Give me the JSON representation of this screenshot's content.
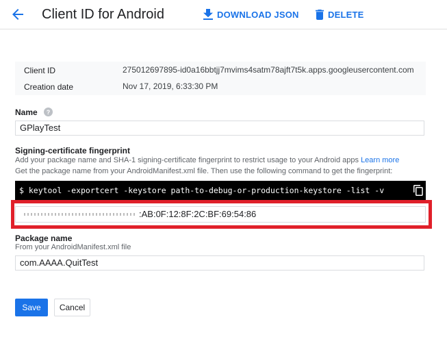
{
  "header": {
    "title": "Client ID for Android",
    "download_label": "DOWNLOAD JSON",
    "delete_label": "DELETE"
  },
  "info": {
    "client_id_label": "Client ID",
    "client_id_value": "275012697895-id0a16bbtjj7mvims4satm78ajft7t5k.apps.googleusercontent.com",
    "creation_date_label": "Creation date",
    "creation_date_value": "Nov 17, 2019, 6:33:30 PM"
  },
  "name_field": {
    "label": "Name",
    "value": "GPlayTest"
  },
  "signing": {
    "label": "Signing-certificate fingerprint",
    "desc_line1": "Add your package name and SHA-1 signing-certificate fingerprint to restrict usage to your Android apps",
    "learn_more": "Learn more",
    "desc_line2": "Get the package name from your AndroidManifest.xml file. Then use the following command to get the fingerprint:",
    "command": "$ keytool -exportcert -keystore path-to-debug-or-production-keystore -list -v",
    "fingerprint_visible": ":AB:0F:12:8F:2C:BF:69:54:86"
  },
  "package": {
    "label": "Package name",
    "desc": "From your AndroidManifest.xml file",
    "value": "com.AAAA.QuitTest"
  },
  "actions": {
    "save_label": "Save",
    "cancel_label": "Cancel"
  },
  "colors": {
    "accent": "#1a73e8",
    "highlight_border": "#e0202a"
  }
}
